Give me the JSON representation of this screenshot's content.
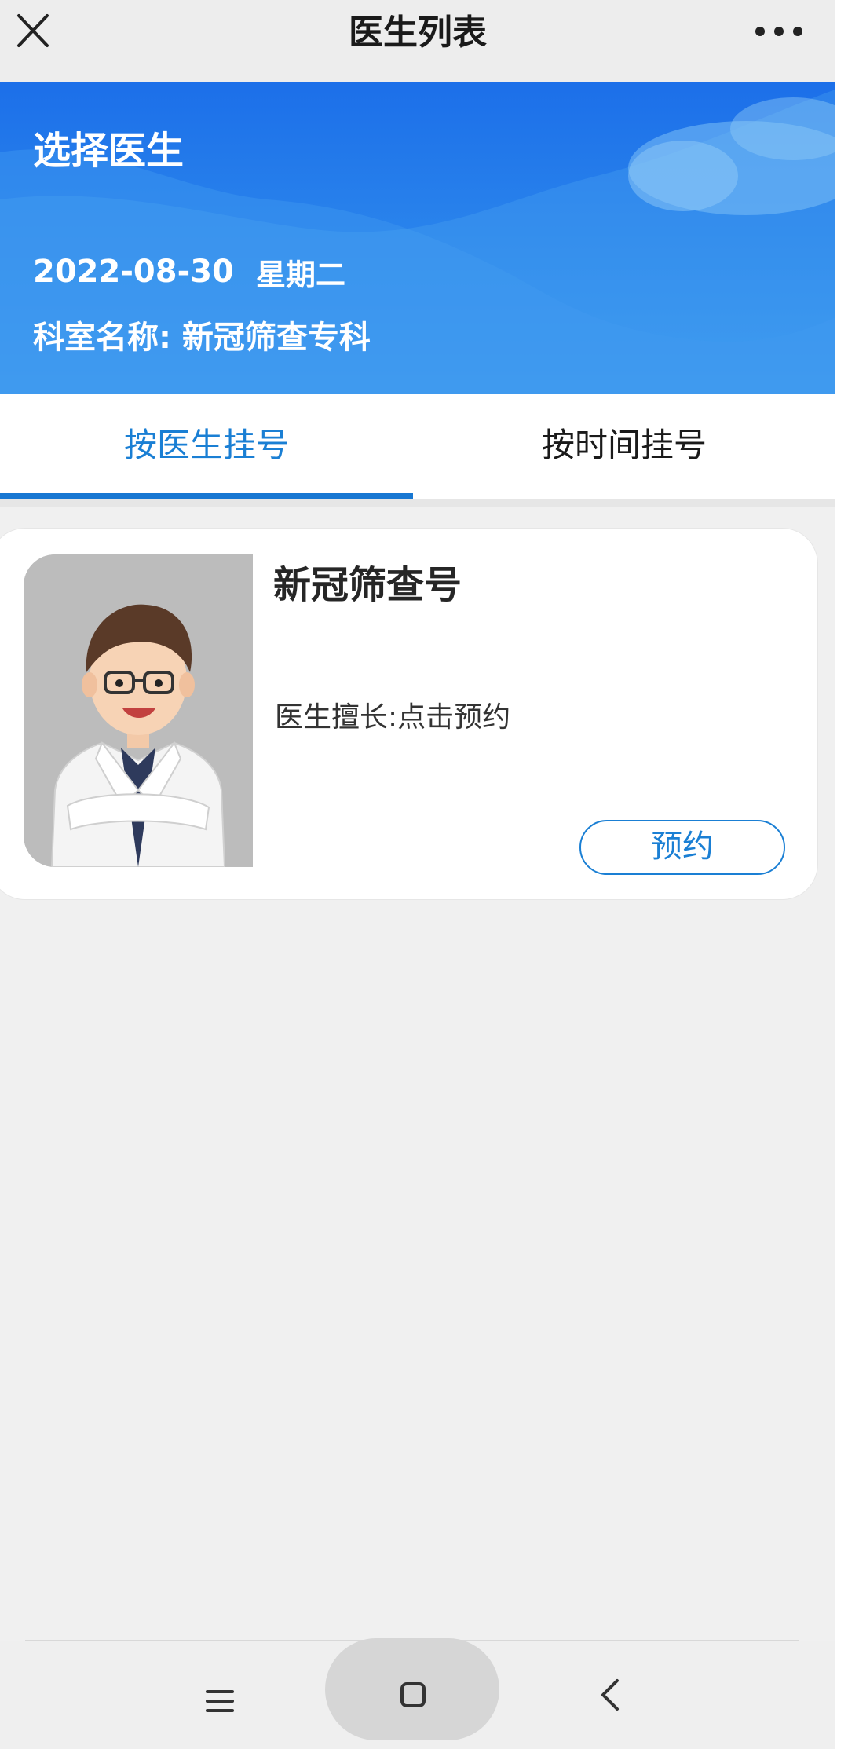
{
  "navbar": {
    "title": "医生列表",
    "close_icon": "close-icon",
    "more_icon": "more-icon"
  },
  "banner": {
    "heading": "选择医生",
    "date": "2022-08-30",
    "weekday": "星期二",
    "department": "科室名称: 新冠筛查专科",
    "colors": {
      "top": "#1c6fe9",
      "bottom": "#3a99ef"
    }
  },
  "tabs": [
    {
      "label": "按医生挂号",
      "active": true
    },
    {
      "label": "按时间挂号",
      "active": false
    }
  ],
  "doctor_card": {
    "name": "新冠筛查号",
    "specialty": "医生擅长:点击预约",
    "book_label": "预约",
    "avatar_icon": "doctor-avatar"
  },
  "system_nav": {
    "menu_icon": "menu-icon",
    "home_icon": "home-icon",
    "back_icon": "back-icon"
  },
  "colors": {
    "accent": "#1a7fd4",
    "page_background": "#f0f0f0"
  }
}
